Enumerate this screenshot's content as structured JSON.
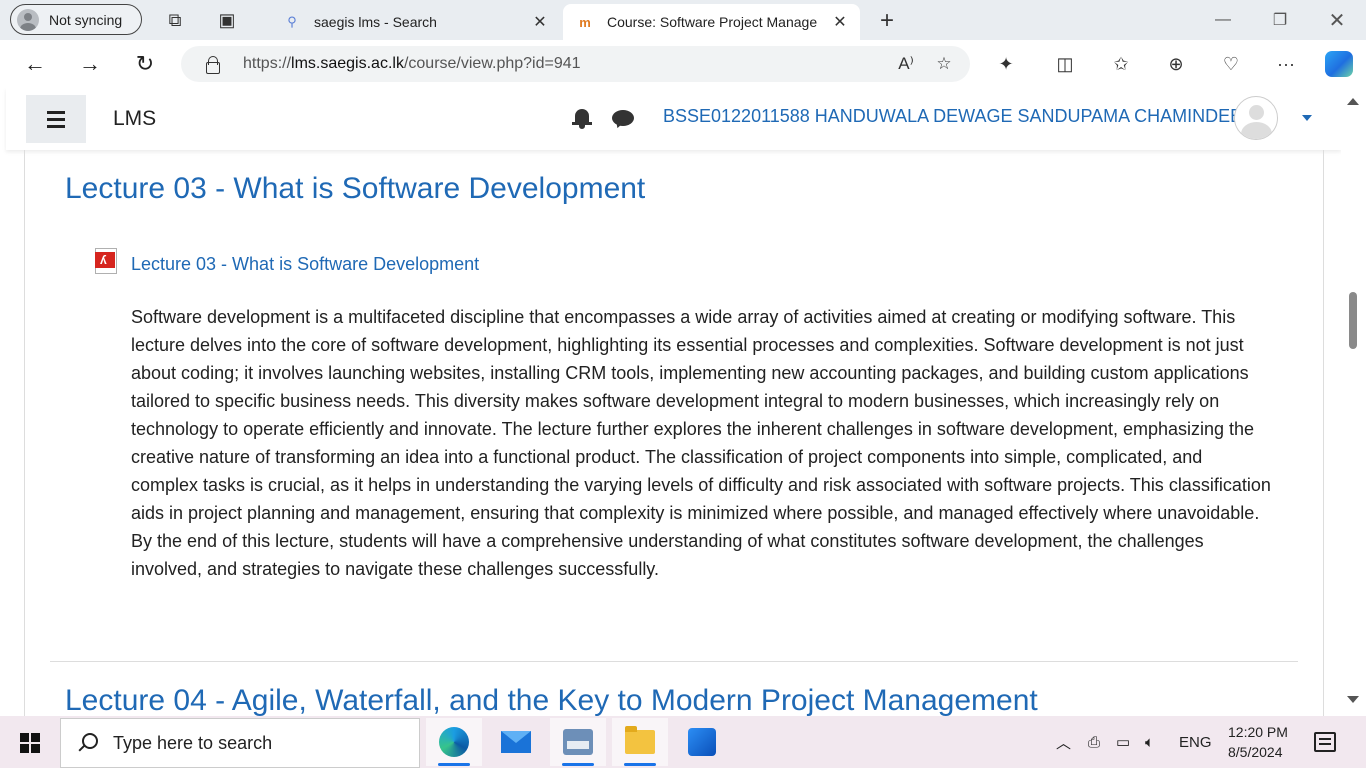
{
  "browser": {
    "profile_label": "Not syncing",
    "tabs": [
      {
        "title": "saegis lms - Search",
        "active": false
      },
      {
        "title": "Course: Software Project Manage",
        "active": true
      }
    ],
    "url_prefix": "https://",
    "url_host": "lms.saegis.ac.lk",
    "url_path": "/course/view.php?id=941"
  },
  "site": {
    "brand": "LMS",
    "username": "BSSE0122011588 HANDUWALA DEWAGE SANDUPAMA CHAMINDEE"
  },
  "sections": [
    {
      "title": "Lecture 03 - What is Software Development",
      "activity_label": "Lecture 03 - What is Software Development",
      "activity_type": "pdf-icon",
      "summary": "Software development is a multifaceted discipline that encompasses a wide array of activities aimed at creating or modifying software. This lecture delves into the core of software development, highlighting its essential processes and complexities. Software development is not just about coding; it involves launching websites, installing CRM tools, implementing new accounting packages, and building custom applications tailored to specific business needs. This diversity makes software development integral to modern businesses, which increasingly rely on technology to operate efficiently and innovate. The lecture further explores the inherent challenges in software development, emphasizing the creative nature of transforming an idea into a functional product. The classification of project components into simple, complicated, and complex tasks is crucial, as it helps in understanding the varying levels of difficulty and risk associated with software projects. This classification aids in project planning and management, ensuring that complexity is minimized where possible, and managed effectively where unavoidable. By the end of this lecture, students will have a comprehensive understanding of what constitutes software development, the challenges involved, and strategies to navigate these challenges successfully."
    },
    {
      "title": "Lecture 04 - Agile, Waterfall, and the Key to Modern Project Management"
    }
  ],
  "taskbar": {
    "search_placeholder": "Type here to search",
    "language": "ENG",
    "time": "12:20 PM",
    "date": "8/5/2024"
  },
  "colors": {
    "link": "#1f69b5",
    "pdf_red": "#d6251e"
  }
}
